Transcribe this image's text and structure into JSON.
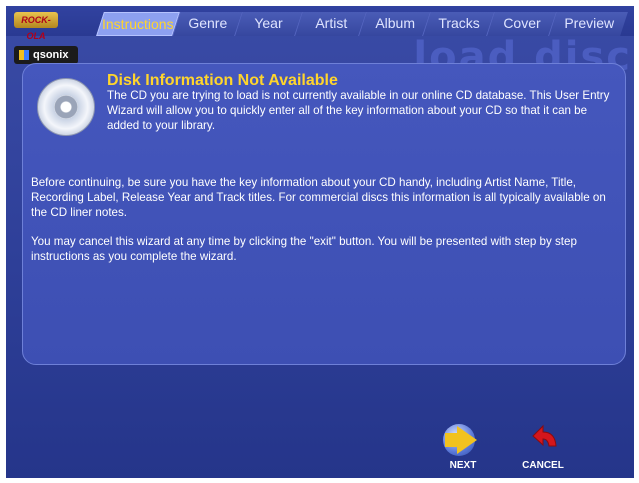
{
  "logos": {
    "rockola": "ROCK-OLA",
    "qsonix": "qsonix"
  },
  "watermark": "load disc",
  "tabs": [
    {
      "label": "Instructions",
      "active": true
    },
    {
      "label": "Genre",
      "active": false
    },
    {
      "label": "Year",
      "active": false
    },
    {
      "label": "Artist",
      "active": false
    },
    {
      "label": "Album",
      "active": false
    },
    {
      "label": "Tracks",
      "active": false
    },
    {
      "label": "Cover",
      "active": false
    },
    {
      "label": "Preview",
      "active": false
    }
  ],
  "panel": {
    "title": "Disk Information Not Available",
    "intro": "The CD you are trying to load is not currently available in our online CD database. This User Entry Wizard will allow you to quickly enter all of the key information about your CD so that it can be added to your library.",
    "paragraph2": "Before continuing, be sure you have the key information about your CD handy, including Artist Name, Title, Recording Label, Release Year and Track titles. For commercial discs this information is all typically available on the CD liner notes.",
    "paragraph3": "You may cancel this wizard at any time by clicking the \"exit\" button. You will be presented with step by step instructions as you complete the wizard."
  },
  "buttons": {
    "next": "NEXT",
    "cancel": "CANCEL"
  },
  "colors": {
    "accent_yellow": "#ffd52c",
    "background_blue": "#3a4ba6",
    "arrow_yellow": "#f2c21f",
    "arrow_red": "#d4161c"
  },
  "icons": {
    "disc": "cd-disc-icon",
    "next": "next-arrow-icon",
    "cancel": "cancel-arrow-icon"
  }
}
